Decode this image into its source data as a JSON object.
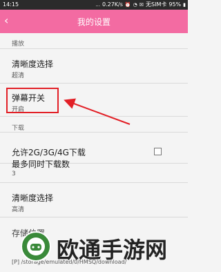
{
  "status": {
    "time": "14:15",
    "dots": "...",
    "speed": "0.27K/s",
    "carrier": "无SIM卡",
    "battery": "95%"
  },
  "header": {
    "title": "我的设置"
  },
  "sections": {
    "play": "播放",
    "download": "下载"
  },
  "items": {
    "clarity_play_title": "清晰度选择",
    "clarity_play_value": "超清",
    "danmaku_title": "弹幕开关",
    "danmaku_value": "开启",
    "allow_mobile_title": "允许2G/3G/4G下载",
    "max_download_title": "最多同时下载数",
    "max_download_value": "3",
    "clarity_dl_title": "清晰度选择",
    "clarity_dl_value": "高清",
    "storage_title": "存储位置",
    "storage_path": "[P] /storage/emulated/0/HMSQ/download/"
  },
  "watermark": {
    "text": "欧通手游网"
  },
  "colors": {
    "accent": "#f36ba2",
    "highlight": "#e21f26"
  }
}
